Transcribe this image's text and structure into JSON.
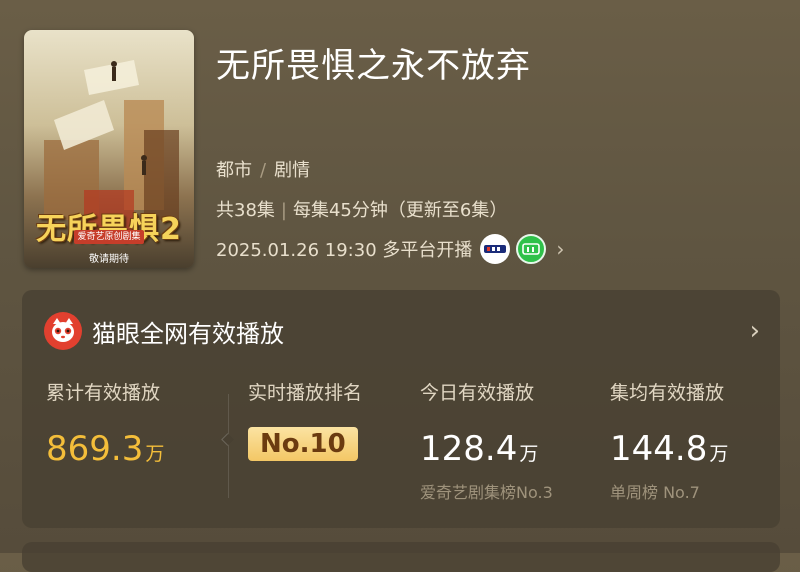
{
  "poster": {
    "title": "无所畏惧2",
    "badge": "爱奇艺原创剧集",
    "coming": "敬请期待"
  },
  "drama": {
    "title": "无所畏惧之永不放弃",
    "genres": [
      "都市",
      "剧情"
    ],
    "episodes": "共38集",
    "duration": "每集45分钟（更新至6集）",
    "airdate": "2025.01.26 19:30 多平台开播"
  },
  "platforms": [
    "cctv-logo",
    "iqiyi-logo"
  ],
  "card": {
    "title": "猫眼全网有效播放",
    "metrics": [
      {
        "label": "累计有效播放",
        "value": "869.3",
        "unit": "万",
        "sub": ""
      },
      {
        "label": "实时播放排名",
        "value": "No.10",
        "unit": "",
        "sub": ""
      },
      {
        "label": "今日有效播放",
        "value": "128.4",
        "unit": "万",
        "sub": "爱奇艺剧集榜No.3"
      },
      {
        "label": "集均有效播放",
        "value": "144.8",
        "unit": "万",
        "sub": "单周榜 No.7"
      }
    ]
  },
  "colors": {
    "accent_gold": "#f4be3a",
    "maoyan_red": "#e2402f",
    "iqiyi_green": "#2fc14a"
  }
}
